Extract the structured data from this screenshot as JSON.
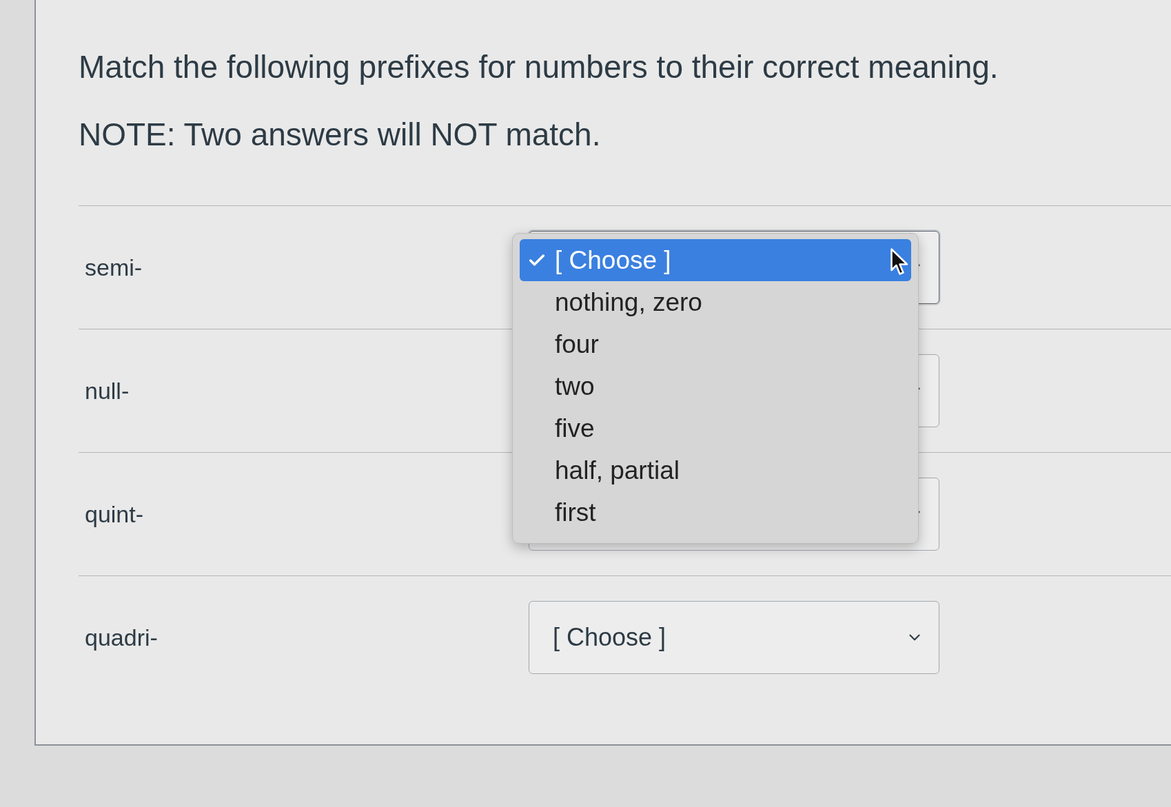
{
  "question": {
    "prompt": "Match the following prefixes for numbers to their correct meaning.",
    "note": "NOTE: Two answers will NOT match."
  },
  "rows": [
    {
      "prefix": "semi-",
      "expanded": true,
      "options": [
        {
          "label": "[ Choose ]",
          "selected": true
        },
        {
          "label": "nothing, zero",
          "selected": false
        },
        {
          "label": "four",
          "selected": false
        },
        {
          "label": "two",
          "selected": false
        },
        {
          "label": "five",
          "selected": false
        },
        {
          "label": "half, partial",
          "selected": false
        },
        {
          "label": "first",
          "selected": false
        }
      ]
    },
    {
      "prefix": "null-",
      "expanded": false
    },
    {
      "prefix": "quint-",
      "expanded": false
    },
    {
      "prefix": "quadri-",
      "expanded": false,
      "value": "[ Choose ]"
    }
  ]
}
